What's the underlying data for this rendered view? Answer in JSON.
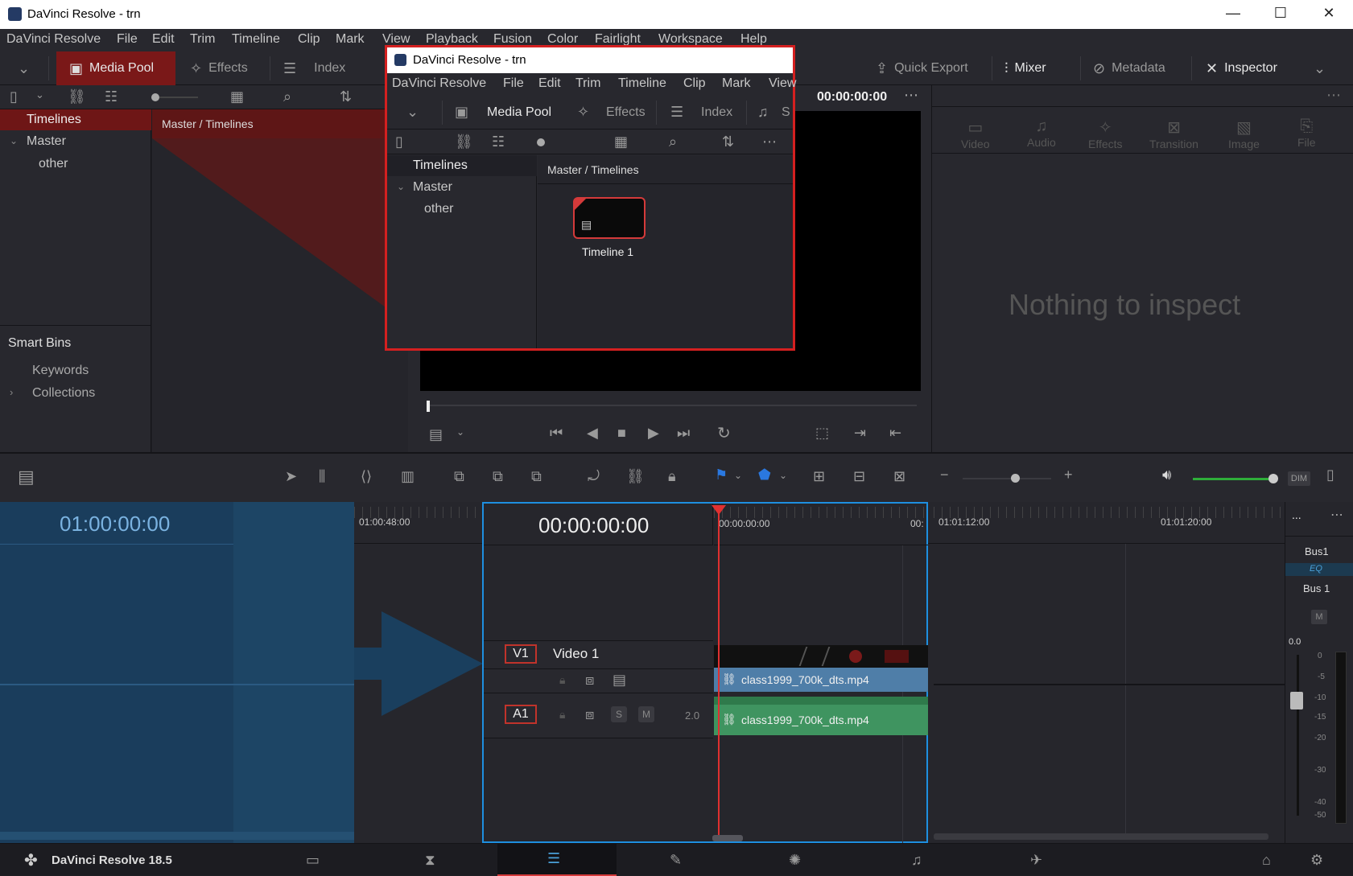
{
  "window": {
    "title": "DaVinci Resolve - trn",
    "minimize": "—",
    "maximize": "☐",
    "close": "✕"
  },
  "menu": [
    "DaVinci Resolve",
    "File",
    "Edit",
    "Trim",
    "Timeline",
    "Clip",
    "Mark",
    "View",
    "Playback",
    "Fusion",
    "Color",
    "Fairlight",
    "Workspace",
    "Help"
  ],
  "toolbar": {
    "media_pool": "Media Pool",
    "effects": "Effects",
    "index": "Index",
    "quick_export": "Quick Export",
    "mixer": "Mixer",
    "metadata": "Metadata",
    "inspector": "Inspector"
  },
  "viewer": {
    "timecode": "00:00:00:00"
  },
  "bins": {
    "timelines": "Timelines",
    "master": "Master",
    "other": "other",
    "smart_bins": "Smart Bins",
    "keywords": "Keywords",
    "collections": "Collections"
  },
  "pool": {
    "breadcrumb": "Master / Timelines"
  },
  "inspector": {
    "tabs": [
      "Video",
      "Audio",
      "Effects",
      "Transition",
      "Image",
      "File"
    ],
    "empty_text": "Nothing to inspect"
  },
  "popup": {
    "title": "DaVinci Resolve - trn",
    "menu": [
      "DaVinci Resolve",
      "File",
      "Edit",
      "Trim",
      "Timeline",
      "Clip",
      "Mark",
      "View"
    ],
    "media_pool": "Media Pool",
    "effects": "Effects",
    "index": "Index",
    "cut_label": "S",
    "timelines": "Timelines",
    "master": "Master",
    "other": "other",
    "breadcrumb": "Master / Timelines",
    "timeline_item": "Timeline 1"
  },
  "timeline": {
    "left_timecode": "01:00:00:00",
    "main_timecode": "00:00:00:00",
    "ruler": [
      "01:00:48:00",
      "00:00:00:00",
      "00:",
      "01:01:12:00",
      "01:01:20:00"
    ],
    "v1_tag": "V1",
    "v1_name": "Video 1",
    "a1_tag": "A1",
    "a1_solo": "S",
    "a1_mute": "M",
    "a1_channels": "2.0",
    "video_clip": "class1999_700k_dts.mp4",
    "audio_clip": "class1999_700k_dts.mp4"
  },
  "mixer": {
    "more": "...",
    "bus_label_1": "Bus1",
    "eq": "EQ",
    "bus_label_2": "Bus 1",
    "mute": "M",
    "level": "0.0",
    "scale": [
      "0",
      "-5",
      "-10",
      "-15",
      "-20",
      "-30",
      "-40",
      "-50"
    ]
  },
  "tl_toolbar": {
    "dim": "DIM"
  },
  "pagebar": {
    "app_name": "DaVinci Resolve 18.5"
  },
  "colors": {
    "accent_red": "#d42020",
    "selection_blue": "#1e8fe0",
    "video_clip": "#4f7ea8",
    "audio_clip": "#3f9460",
    "playhead": "#e03030"
  }
}
